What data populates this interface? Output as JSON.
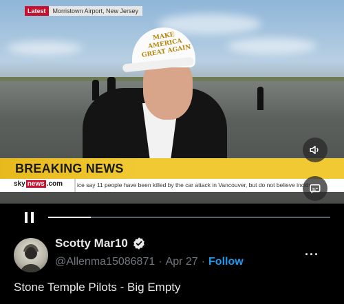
{
  "video": {
    "location_tag": "Latest",
    "location_name": "Morristown Airport, New Jersey",
    "breaking_label": "BREAKING NEWS",
    "sky_brand_left": "sky",
    "sky_brand_news": "news",
    "sky_brand_right": ".com",
    "ticker": "ice say 11 people have been killed by the car attack in Vancouver, but do not believe incide",
    "hat_text": "MAKE AMERICA GREAT AGAIN",
    "progress": 0.15
  },
  "post": {
    "display_name": "Scotty Mar10",
    "handle": "@Allenma15086871",
    "separator": "·",
    "date": "Apr 27",
    "follow_label": "Follow",
    "more_label": "···",
    "text": "Stone Temple Pilots - Big Empty"
  },
  "colors": {
    "accent": "#1d9bf0",
    "verified": "#e7e9ea",
    "breaking_bg": "#f1c933",
    "sky_red": "#c8102e"
  }
}
